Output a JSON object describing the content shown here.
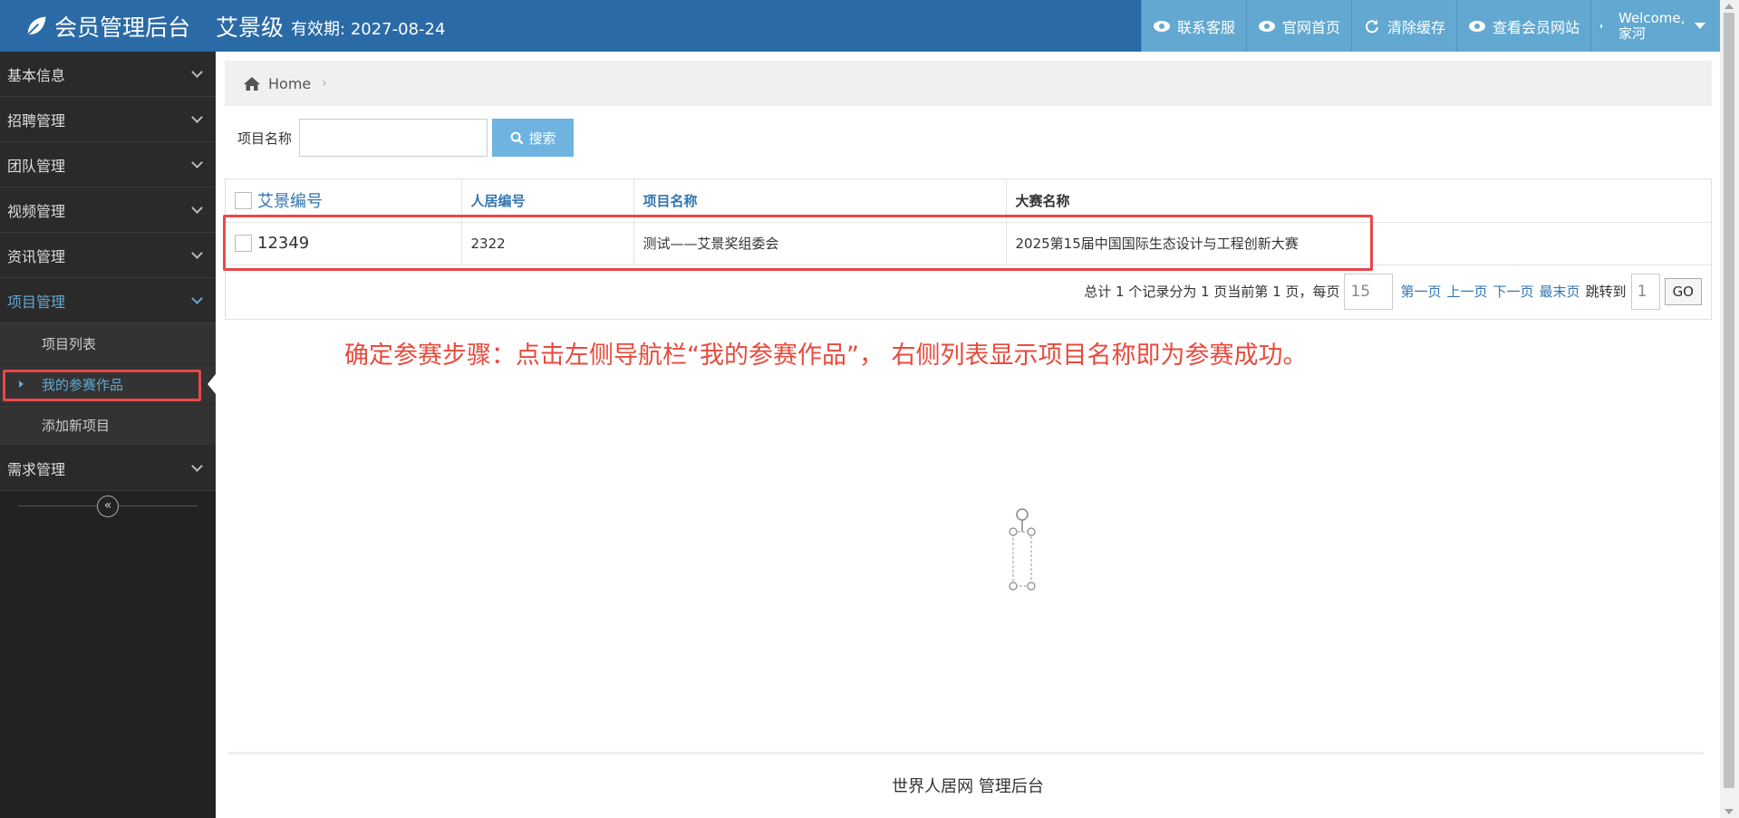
{
  "header": {
    "title": "会员管理后台",
    "member_name": "艾景级",
    "expiry": "有效期: 2027-08-24",
    "buttons": [
      {
        "label": "联系客服",
        "icon": "eye-icon"
      },
      {
        "label": "官网首页",
        "icon": "eye-icon"
      },
      {
        "label": "清除缓存",
        "icon": "refresh-icon"
      },
      {
        "label": "查看会员网站",
        "icon": "eye-icon"
      }
    ],
    "user": {
      "welcome": "Welcome,",
      "name": "家河"
    }
  },
  "sidebar": {
    "items": [
      {
        "label": "基本信息"
      },
      {
        "label": "招聘管理"
      },
      {
        "label": "团队管理"
      },
      {
        "label": "视频管理"
      },
      {
        "label": "资讯管理"
      },
      {
        "label": "项目管理"
      },
      {
        "label": "需求管理"
      }
    ],
    "sub_items": [
      {
        "label": "项目列表"
      },
      {
        "label": "我的参赛作品"
      },
      {
        "label": "添加新项目"
      }
    ],
    "collapse_icon": "«"
  },
  "breadcrumb": {
    "home": "Home",
    "sep": "›"
  },
  "search": {
    "label": "项目名称",
    "value": "",
    "button": "搜索"
  },
  "table": {
    "headers": [
      "艾景编号",
      "人居编号",
      "项目名称",
      "大赛名称"
    ],
    "rows": [
      {
        "aijing_id": "12349",
        "renju_id": "2322",
        "project": "测试——艾景奖组委会",
        "contest": "2025第15届中国国际生态设计与工程创新大赛"
      }
    ]
  },
  "pager": {
    "summary": "总计 1 个记录分为 1 页当前第 1 页，每页",
    "per_page": "15",
    "first": "第一页",
    "prev": "上一页",
    "next": "下一页",
    "last": "最末页",
    "jump_label": "跳转到",
    "jump_value": "1",
    "go": "GO"
  },
  "annotation": "确定参赛步骤：点击左侧导航栏“我的参赛作品”， 右侧列表显示项目名称即为参赛成功。",
  "footer": "世界人居网 管理后台",
  "colors": {
    "header": "#2a6aa6",
    "nav_button": "#62a8d1",
    "highlight": "#e8484a",
    "link": "#3276b1"
  }
}
